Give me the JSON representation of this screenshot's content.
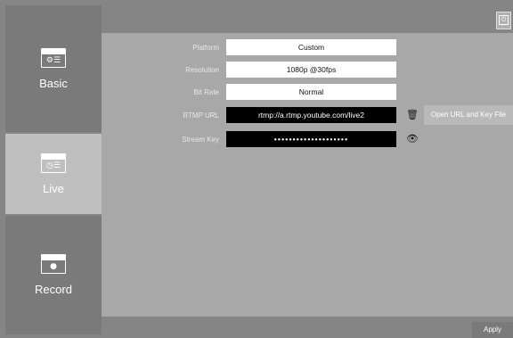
{
  "sidebar": {
    "tabs": [
      {
        "label": "Basic",
        "icon": "settings-window-icon"
      },
      {
        "label": "Live",
        "icon": "live-window-icon",
        "active": true
      },
      {
        "label": "Record",
        "icon": "record-window-icon"
      }
    ]
  },
  "form": {
    "platform": {
      "label": "Platform",
      "value": "Custom"
    },
    "resolution": {
      "label": "Resolution",
      "value": "1080p @30fps"
    },
    "bitrate": {
      "label": "Bit Rate",
      "value": "Normal"
    },
    "rtmp_url": {
      "label": "RTMP URL",
      "value": "rtmp://a.rtmp.youtube.com/live2"
    },
    "stream_key": {
      "label": "Stream Key",
      "value": "••••••••••••••••••••"
    }
  },
  "actions": {
    "open_file_label": "Open URL and Key File",
    "apply_label": "Apply"
  },
  "colors": {
    "background": "#858585",
    "panel": "#a8a8a8",
    "active_tab": "#bfbfbf"
  }
}
